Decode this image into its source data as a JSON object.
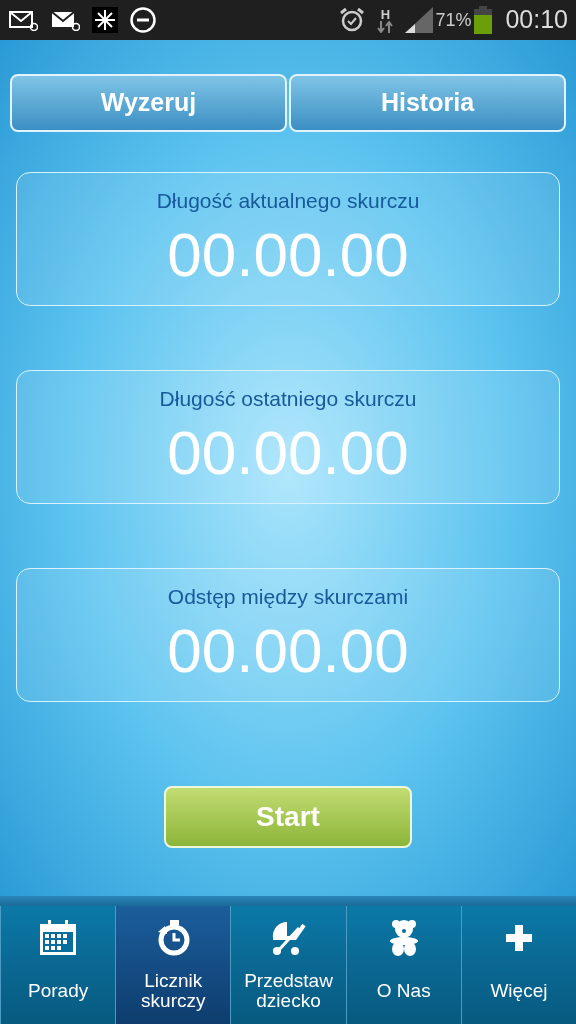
{
  "status_bar": {
    "network_type": "H",
    "battery_text": "71%",
    "time": "00:10"
  },
  "top_buttons": [
    {
      "label": "Wyzeruj"
    },
    {
      "label": "Historia"
    }
  ],
  "timers": [
    {
      "label": "Długość aktualnego skurczu",
      "value": "00.00.00"
    },
    {
      "label": "Długość ostatniego skurczu",
      "value": "00.00.00"
    },
    {
      "label": "Odstęp między skurczami",
      "value": "00.00.00"
    }
  ],
  "start_button": {
    "label": "Start"
  },
  "bottom_nav": [
    {
      "kind": "calendar",
      "label": "Porady",
      "selected": false
    },
    {
      "kind": "stopwatch",
      "label": "Licznik skurczy",
      "selected": true
    },
    {
      "kind": "stroller",
      "label": "Przedstaw dziecko",
      "selected": false
    },
    {
      "kind": "teddy",
      "label": "O Nas",
      "selected": false
    },
    {
      "kind": "plus",
      "label": "Więcej",
      "selected": false
    }
  ]
}
